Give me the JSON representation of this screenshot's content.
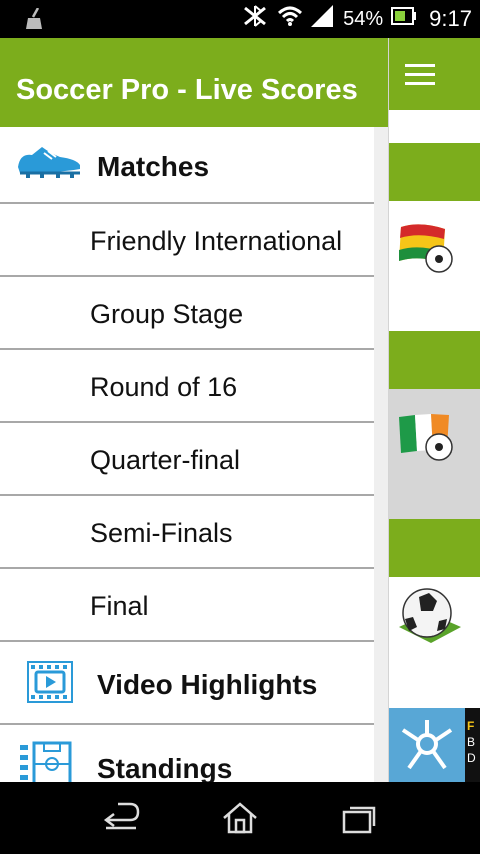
{
  "status_bar": {
    "battery": "54%",
    "time": "9:17",
    "icons": [
      "broom-icon",
      "bluetooth-x-icon",
      "wifi-icon",
      "signal-icon",
      "battery-icon"
    ]
  },
  "drawer": {
    "title": "Soccer Pro - Live Scores",
    "header_color": "#7cad1c",
    "sections": [
      {
        "label": "Matches",
        "icon": "cleat-icon"
      },
      {
        "label": "Video Highlights",
        "icon": "video-icon"
      },
      {
        "label": "Standings",
        "icon": "standings-icon"
      }
    ],
    "sub_items": [
      "Friendly International",
      "Group Stage",
      "Round of 16",
      "Quarter-final",
      "Semi-Finals",
      "Final"
    ]
  },
  "background_app": {
    "icons": [
      "ghana-flag-ball-icon",
      "ireland-flag-ball-icon",
      "soccer-ball-icon",
      "ad-logo-icon"
    ],
    "ad_text": "F\nB\nD"
  },
  "nav_bar": {
    "buttons": [
      "back-icon",
      "home-icon",
      "recents-icon"
    ]
  }
}
